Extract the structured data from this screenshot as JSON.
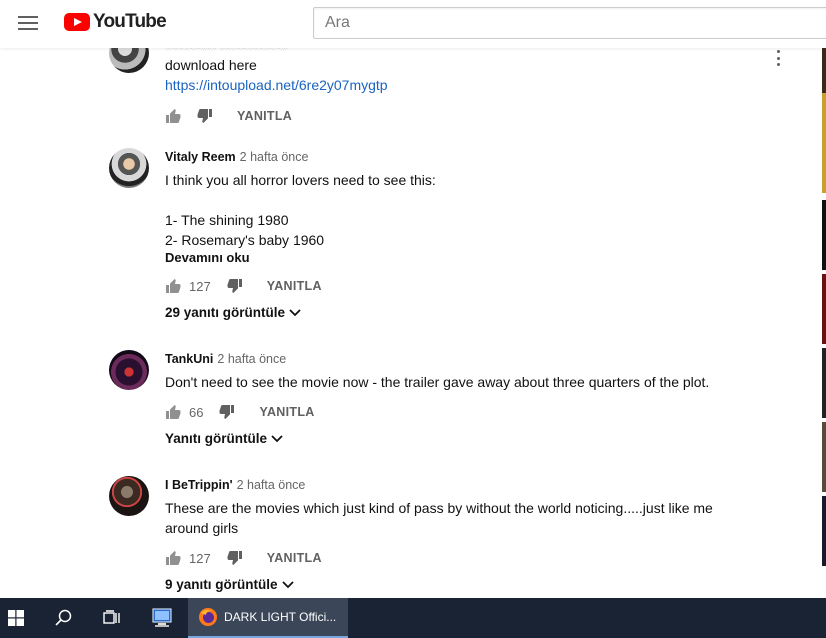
{
  "header": {
    "logo_text": "YouTube",
    "search_placeholder": "Ara"
  },
  "comments": [
    {
      "text": "download here",
      "link": "https://intoupload.net/6re2y07mygtp",
      "reply_label": "YANITLA"
    },
    {
      "author": "Vitaly Reem",
      "time": "2 hafta önce",
      "lines": [
        "I think you all horror lovers need to see this:",
        "",
        "1- The shining 1980",
        "2- Rosemary's baby 1960"
      ],
      "read_more": "Devamını oku",
      "likes": "127",
      "reply_label": "YANITLA",
      "replies_toggle": "29 yanıtı görüntüle"
    },
    {
      "author": "TankUni",
      "time": "2 hafta önce",
      "lines": [
        "Don't need to see the movie now - the trailer gave away about three quarters of the plot."
      ],
      "likes": "66",
      "reply_label": "YANITLA",
      "replies_toggle": "Yanıtı görüntüle"
    },
    {
      "author": "I BeTrippin'",
      "time": "2 hafta önce",
      "lines": [
        "These are the movies which just kind of pass by without the world noticing.....just like me",
        "around girls"
      ],
      "likes": "127",
      "reply_label": "YANITLA",
      "replies_toggle": "9 yanıtı görüntüle"
    }
  ],
  "taskbar": {
    "active_window": "DARK LIGHT Offici..."
  },
  "colors": {
    "link": "#1a63c2",
    "brand_red": "#ff0000",
    "taskbar_bg": "#1a2333"
  }
}
